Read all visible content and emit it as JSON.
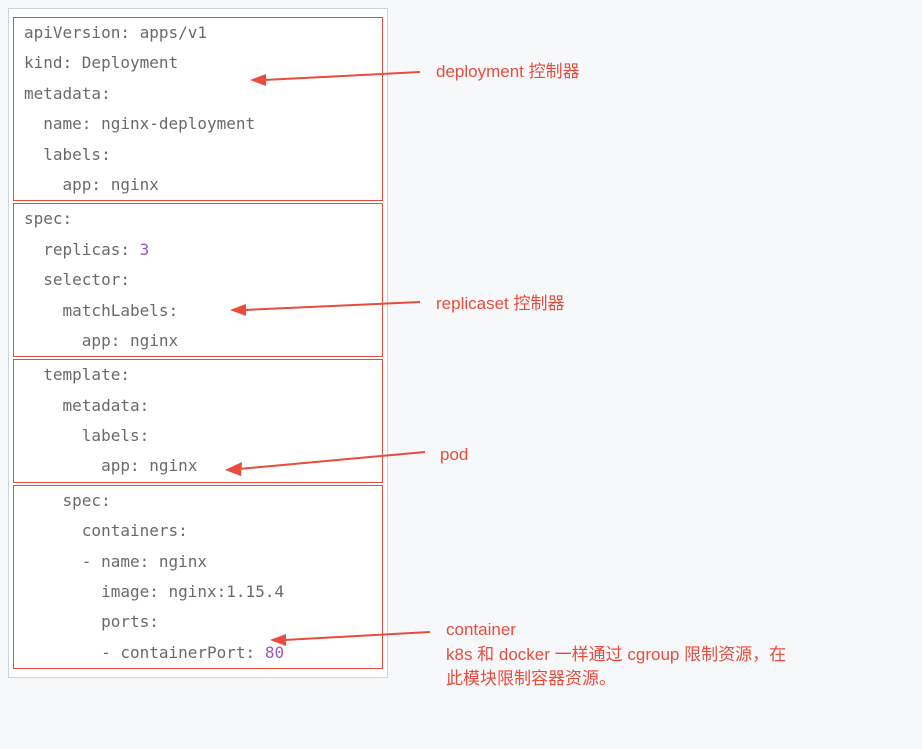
{
  "annotations": {
    "a1": "deployment 控制器",
    "a2": "replicaset 控制器",
    "a3": "pod",
    "a4_line1": "container",
    "a4_line2": "k8s 和 docker 一样通过 cgroup 限制资源，在",
    "a4_line3": "此模块限制容器资源。"
  },
  "yaml": {
    "l1": "apiVersion: apps/v1",
    "l2": "kind: Deployment",
    "l3": "metadata:",
    "l4": "  name: nginx-deployment",
    "l5": "  labels:",
    "l6": "    app: nginx",
    "l7": "spec:",
    "l8_before_num": "  replicas: ",
    "l8_num": "3",
    "l9": "  selector:",
    "l10": "    matchLabels:",
    "l11": "      app: nginx",
    "l12": "  template:",
    "l13": "    metadata:",
    "l14": "      labels:",
    "l15": "        app: nginx",
    "l16": "    spec:",
    "l17": "      containers:",
    "l18": "      - name: nginx",
    "l19": "        image: nginx:1.15.4",
    "l20": "        ports:",
    "l21_before_num": "        - containerPort: ",
    "l21_num": "80"
  }
}
